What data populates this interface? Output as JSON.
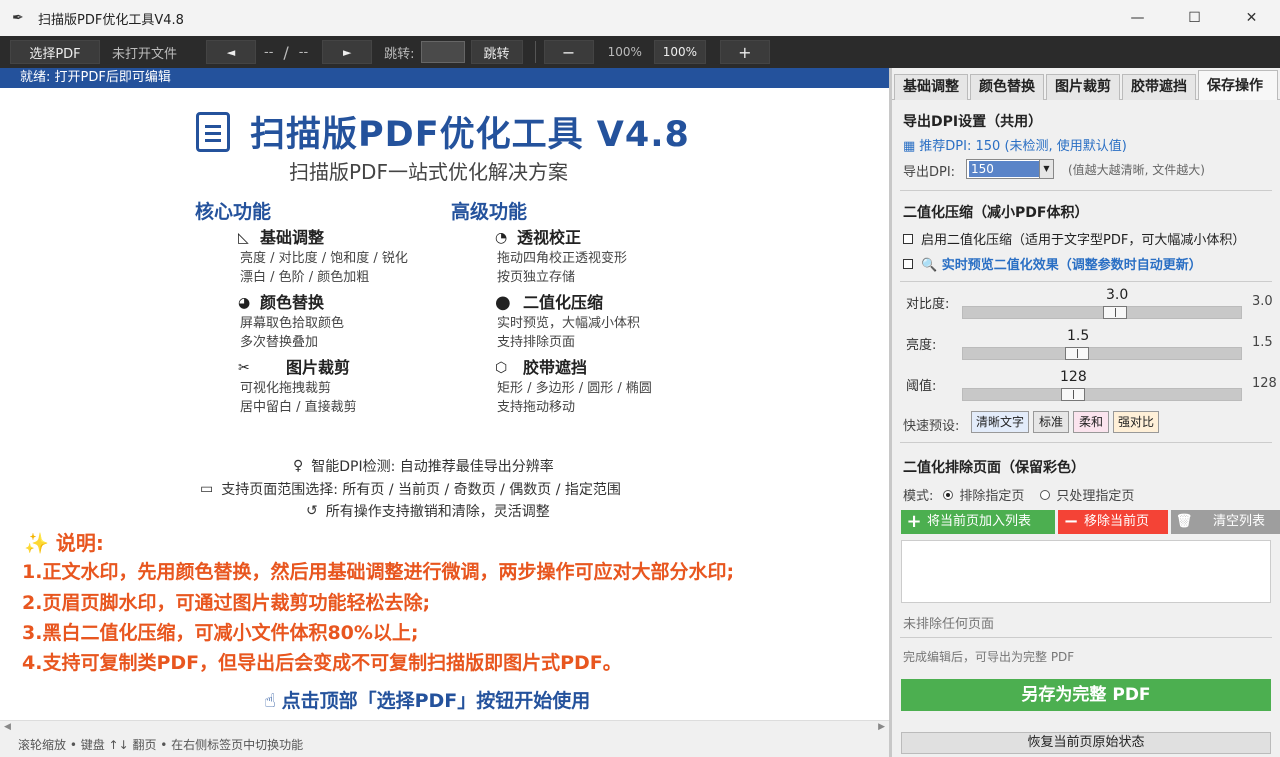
{
  "window": {
    "title": "扫描版PDF优化工具V4.8",
    "app_icon": "feather-icon",
    "minimize": "—",
    "maximize": "☐",
    "close": "✕"
  },
  "toolbar": {
    "select_pdf": "选择PDF",
    "file_status": "未打开文件",
    "prev": "◄",
    "page_current": "--",
    "page_sep": "/",
    "page_total": "--",
    "next": "►",
    "jump_label": "跳转:",
    "jump_value": "",
    "jump_btn": "跳转",
    "zoom_out": "−",
    "zoom_level": "100%",
    "zoom_reset": "100%",
    "zoom_in": "+"
  },
  "status": "就绪: 打开PDF后即可编辑",
  "welcome": {
    "title": "扫描版PDF优化工具 V4.8",
    "subtitle": "扫描版PDF一站式优化解决方案",
    "core_title": "核心功能",
    "advanced_title": "高级功能",
    "core": [
      {
        "icon": "ruler-icon",
        "glyph": "◺",
        "title": "基础调整",
        "lines": [
          "亮度 / 对比度 / 饱和度 / 锐化",
          "漂白 / 色阶 / 颜色加粗"
        ]
      },
      {
        "icon": "palette-icon",
        "glyph": "◕",
        "title": "颜色替换",
        "lines": [
          "屏幕取色拾取颜色",
          "多次替换叠加"
        ]
      },
      {
        "icon": "scissors-icon",
        "glyph": "✂",
        "title": "图片裁剪",
        "lines": [
          "可视化拖拽裁剪",
          "居中留白 / 直接裁剪"
        ]
      }
    ],
    "advanced": [
      {
        "icon": "perspective-icon",
        "glyph": "◔",
        "title": "透视校正",
        "lines": [
          "拖动四角校正透视变形",
          "按页独立存储"
        ]
      },
      {
        "icon": "circle-icon",
        "glyph": "●",
        "title": "二值化压缩",
        "lines": [
          "实时预览，大幅减小体积",
          "支持排除页面"
        ]
      },
      {
        "icon": "box-icon",
        "glyph": "⬡",
        "title": "胶带遮挡",
        "lines": [
          "矩形 / 多边形 / 圆形 / 椭圆",
          "支持拖动移动"
        ]
      }
    ],
    "info": [
      {
        "icon": "lightbulb-icon",
        "glyph": "♀",
        "text": "智能DPI检测: 自动推荐最佳导出分辨率"
      },
      {
        "icon": "folder-icon",
        "glyph": "▭",
        "text": "支持页面范围选择: 所有页 / 当前页 / 奇数页 / 偶数页 / 指定范围"
      },
      {
        "icon": "undo-icon",
        "glyph": "↺",
        "text": "所有操作支持撤销和清除，灵活调整"
      }
    ],
    "notes_title": "✨ 说明:",
    "notes": [
      "1.正文水印，先用颜色替换，然后用基础调整进行微调，两步操作可应对大部分水印;",
      "2.页眉页脚水印，可通过图片裁剪功能轻松去除;",
      "3.黑白二值化压缩，可减小文件体积80%以上;",
      "4.支持可复制类PDF，但导出后会变成不可复制扫描版即图片式PDF。"
    ],
    "cta": "点击顶部「选择PDF」按钮开始使用",
    "cta_icon": "pointer-hand-icon"
  },
  "footer": "滚轮缩放  •  键盘 ↑↓ 翻页  •  在右侧标签页中切换功能",
  "tabs": [
    "基础调整",
    "颜色替换",
    "图片裁剪",
    "胶带遮挡",
    "保存操作"
  ],
  "panel": {
    "dpi_title": "导出DPI设置（共用）",
    "dpi_recommend": "推荐DPI: 150 (未检测, 使用默认值)",
    "dpi_label": "导出DPI:",
    "dpi_value": "150",
    "dpi_hint": "(值越大越清晰, 文件越大)",
    "bin_title": "二值化压缩（减小PDF体积）",
    "bin_enable": "启用二值化压缩（适用于文字型PDF，可大幅减小体积）",
    "bin_preview": "🔍 实时预览二值化效果（调整参数时自动更新）",
    "sliders": [
      {
        "label": "对比度:",
        "value": "3.0",
        "end": "3.0"
      },
      {
        "label": "亮度:",
        "value": "1.5",
        "end": "1.5"
      },
      {
        "label": "阈值:",
        "value": "128",
        "end": "128"
      }
    ],
    "preset_label": "快速预设:",
    "presets": [
      "清晰文字",
      "标准",
      "柔和",
      "强对比"
    ],
    "exclude_title": "二值化排除页面（保留彩色）",
    "mode_label": "模式:",
    "mode_exclude": "排除指定页",
    "mode_only": "只处理指定页",
    "btn_add": "将当前页加入列表",
    "btn_remove": "移除当前页",
    "btn_clear": "清空列表",
    "exclude_status": "未排除任何页面",
    "export_hint": "完成编辑后，可导出为完整 PDF",
    "save_btn": "另存为完整 PDF",
    "restore_btn": "恢复当前页原始状态"
  },
  "colors": {
    "accent": "#24529c",
    "note": "#e8561f",
    "green": "#4caf50",
    "red": "#f44336"
  }
}
